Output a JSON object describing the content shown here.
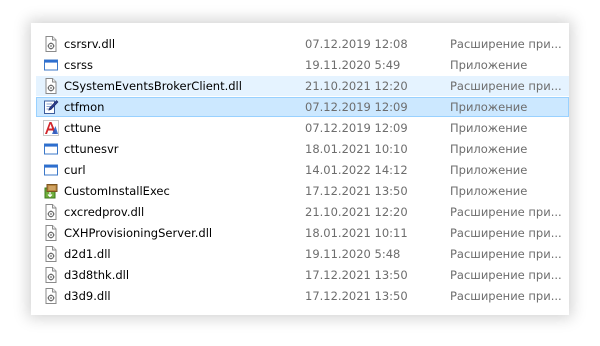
{
  "files": [
    {
      "name": "csrsrv.dll",
      "date": "07.12.2019 12:08",
      "type": "Расширение при...",
      "icon": "dll-file-icon",
      "state": "normal"
    },
    {
      "name": "csrss",
      "date": "19.11.2020 5:49",
      "type": "Приложение",
      "icon": "app-window-icon",
      "state": "normal"
    },
    {
      "name": "CSystemEventsBrokerClient.dll",
      "date": "21.10.2021 12:20",
      "type": "Расширение при...",
      "icon": "dll-file-icon",
      "state": "hover"
    },
    {
      "name": "ctfmon",
      "date": "07.12.2019 12:09",
      "type": "Приложение",
      "icon": "pen-notepad-icon",
      "state": "selected"
    },
    {
      "name": "cttune",
      "date": "07.12.2019 12:09",
      "type": "Приложение",
      "icon": "font-a-icon",
      "state": "normal"
    },
    {
      "name": "cttunesvr",
      "date": "18.01.2021 10:10",
      "type": "Приложение",
      "icon": "app-window-icon",
      "state": "normal"
    },
    {
      "name": "curl",
      "date": "14.01.2022 14:12",
      "type": "Приложение",
      "icon": "app-window-icon",
      "state": "normal"
    },
    {
      "name": "CustomInstallExec",
      "date": "17.12.2021 13:50",
      "type": "Приложение",
      "icon": "installer-box-icon",
      "state": "normal"
    },
    {
      "name": "cxcredprov.dll",
      "date": "21.10.2021 12:20",
      "type": "Расширение при...",
      "icon": "dll-file-icon",
      "state": "normal"
    },
    {
      "name": "CXHProvisioningServer.dll",
      "date": "18.01.2021 10:11",
      "type": "Расширение при...",
      "icon": "dll-file-icon",
      "state": "normal"
    },
    {
      "name": "d2d1.dll",
      "date": "19.11.2020 5:48",
      "type": "Расширение при...",
      "icon": "dll-file-icon",
      "state": "normal"
    },
    {
      "name": "d3d8thk.dll",
      "date": "17.12.2021 13:50",
      "type": "Расширение при...",
      "icon": "dll-file-icon",
      "state": "normal"
    },
    {
      "name": "d3d9.dll",
      "date": "17.12.2021 13:50",
      "type": "Расширение при...",
      "icon": "dll-file-icon",
      "state": "normal"
    }
  ]
}
